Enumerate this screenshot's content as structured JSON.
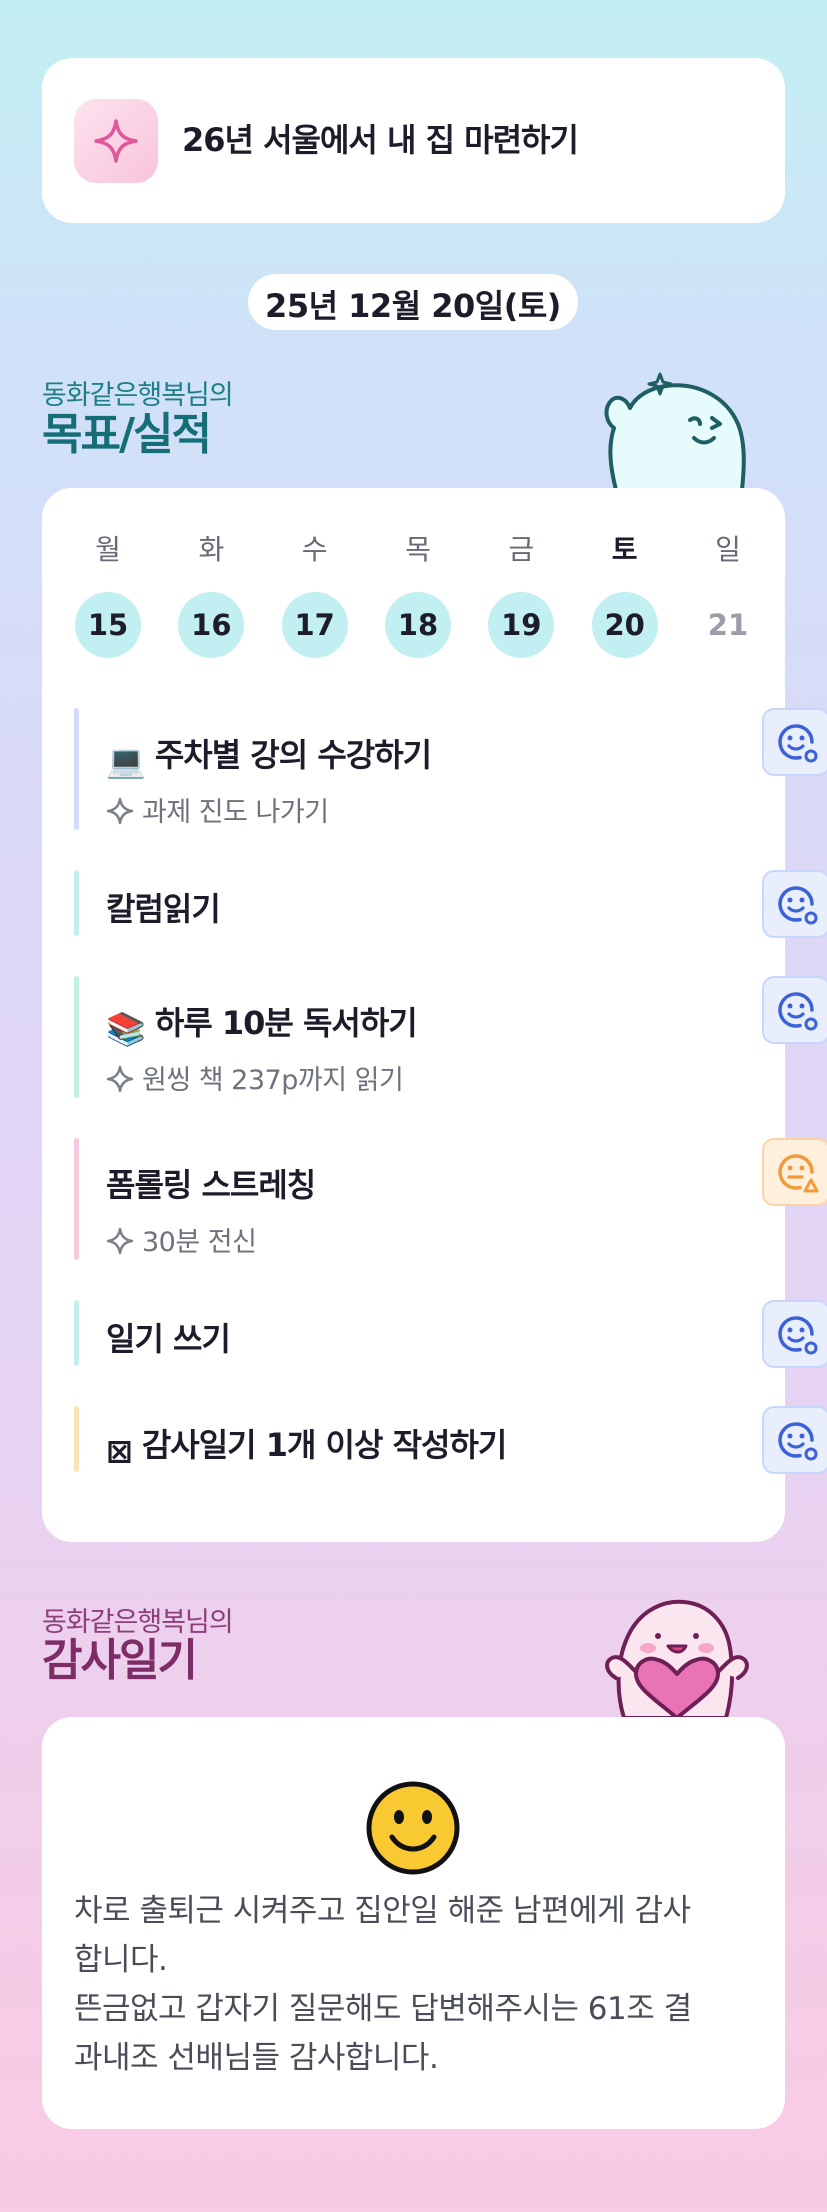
{
  "goal": {
    "title": "26년 서울에서 내 집 마련하기",
    "icon": "sparkle-icon"
  },
  "date": "25년 12월 20일(토)",
  "goals_section": {
    "subtitle": "동화같은행복님의",
    "title": "목표/실적"
  },
  "week": [
    {
      "name": "월",
      "num": "15",
      "filled": true,
      "today": false
    },
    {
      "name": "화",
      "num": "16",
      "filled": true,
      "today": false
    },
    {
      "name": "수",
      "num": "17",
      "filled": true,
      "today": false
    },
    {
      "name": "목",
      "num": "18",
      "filled": true,
      "today": false
    },
    {
      "name": "금",
      "num": "19",
      "filled": true,
      "today": false
    },
    {
      "name": "토",
      "num": "20",
      "filled": true,
      "today": true
    },
    {
      "name": "일",
      "num": "21",
      "filled": false,
      "today": false
    }
  ],
  "tasks": [
    {
      "emoji": "💻",
      "title": "주차별 강의 수강하기",
      "sub": "과제 진도 나가기",
      "bar_color": "#d3dcfb",
      "status": "blue"
    },
    {
      "emoji": "",
      "title": "칼럼읽기",
      "sub": "",
      "bar_color": "#c3eff1",
      "status": "blue"
    },
    {
      "emoji": "📚",
      "title": "하루 10분 독서하기",
      "sub": "원씽 책 237p까지 읽기",
      "bar_color": "#c3f0df",
      "status": "blue"
    },
    {
      "emoji": "",
      "title": "폼롤링 스트레칭",
      "sub": "30분 전신",
      "bar_color": "#f8c8df",
      "status": "orange"
    },
    {
      "emoji": "",
      "title": "일기 쓰기",
      "sub": "",
      "bar_color": "#c3eff1",
      "status": "blue"
    },
    {
      "emoji": "⊠",
      "title": "감사일기 1개 이상 작성하기",
      "sub": "",
      "bar_color": "#fbe3b6",
      "status": "blue"
    }
  ],
  "diary_section": {
    "subtitle": "동화같은행복님의",
    "title": "감사일기"
  },
  "diary": {
    "mood_icon": "smiling-face-icon",
    "lines": [
      "차로 출퇴근 시켜주고 집안일 해준 남편에게 감사",
      "합니다.",
      "뜬금없고 갑자기 질문해도 답변해주시는 61조 결",
      "과내조 선배님들 감사합니다."
    ]
  },
  "colors": {
    "goal_teal": "#156d76",
    "diary_plum": "#7d2c67",
    "day_circle": "#c2eff1",
    "status_blue": "#3b62d9",
    "status_orange": "#f29a38"
  }
}
